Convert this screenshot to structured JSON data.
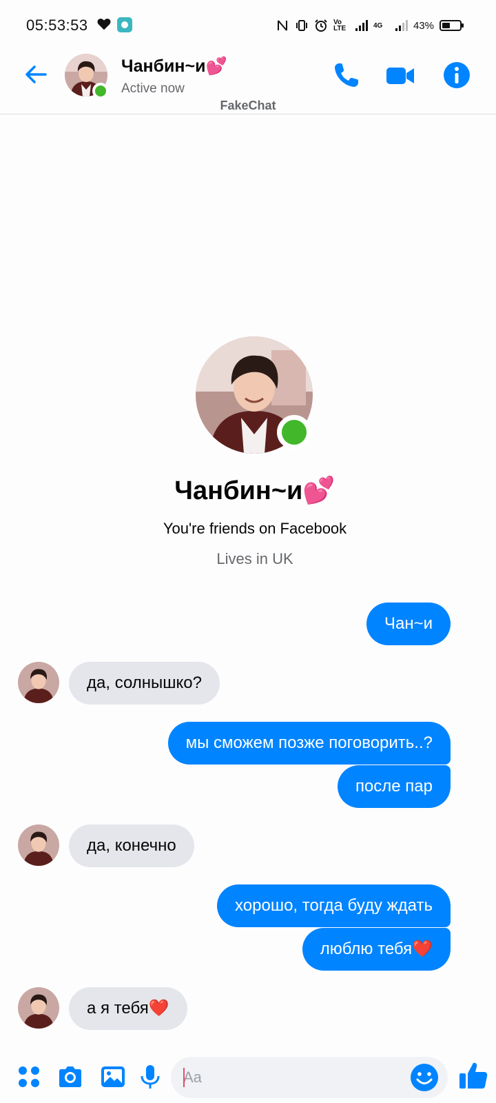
{
  "status_bar": {
    "time": "05:53:53",
    "volte": "Vo LTE",
    "network": "4G",
    "battery": "43%"
  },
  "header": {
    "contact_name": "Чанбин~и💕",
    "status": "Active now",
    "watermark": "FakeChat"
  },
  "profile": {
    "name": "Чанбин~и💕",
    "friends_text": "You're friends on Facebook",
    "location_text": "Lives in UK"
  },
  "messages": [
    {
      "direction": "out",
      "text": "Чан~и"
    },
    {
      "direction": "in",
      "text": "да, солнышко?"
    },
    {
      "direction": "out",
      "text": "мы сможем позже поговорить..?"
    },
    {
      "direction": "out",
      "text": "после пар"
    },
    {
      "direction": "in",
      "text": "да, конечно"
    },
    {
      "direction": "out",
      "text": "хорошо, тогда буду ждать"
    },
    {
      "direction": "out",
      "text": "люблю тебя❤️"
    },
    {
      "direction": "in",
      "text": "а я тебя❤️"
    }
  ],
  "composer": {
    "placeholder": "Aa"
  },
  "colors": {
    "accent": "#0084ff",
    "incoming_bubble": "#e4e6eb",
    "online": "#42b72a"
  },
  "icons": {
    "back": "arrow-left-icon",
    "call": "phone-icon",
    "video": "video-camera-icon",
    "info": "info-icon",
    "apps": "grid-dots-icon",
    "camera": "camera-icon",
    "gallery": "image-icon",
    "voice": "microphone-icon",
    "emoji": "smiley-icon",
    "like": "thumbs-up-icon"
  }
}
